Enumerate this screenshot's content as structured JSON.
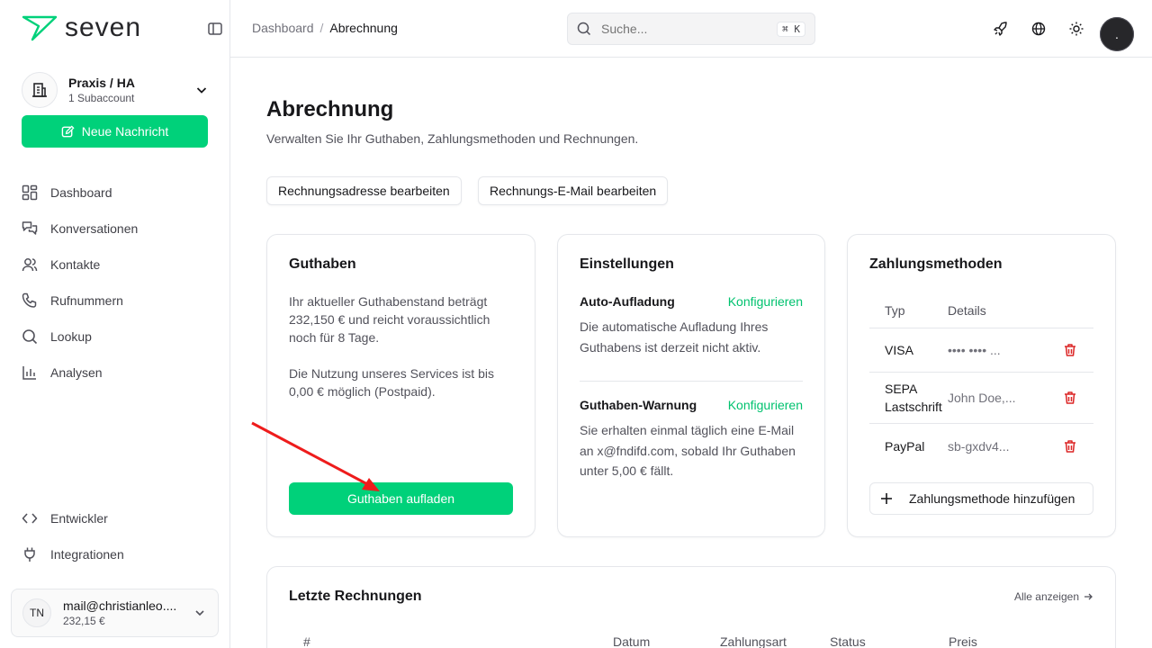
{
  "brand": {
    "name": "seven",
    "accent": "#00d17a"
  },
  "account": {
    "name": "Praxis / HA",
    "sub": "1 Subaccount"
  },
  "sidebar": {
    "new_message": "Neue Nachricht",
    "items": [
      {
        "label": "Dashboard",
        "icon": "dashboard-icon"
      },
      {
        "label": "Konversationen",
        "icon": "chat-icon"
      },
      {
        "label": "Kontakte",
        "icon": "users-icon"
      },
      {
        "label": "Rufnummern",
        "icon": "phone-icon"
      },
      {
        "label": "Lookup",
        "icon": "search-icon"
      },
      {
        "label": "Analysen",
        "icon": "chart-icon"
      }
    ],
    "bottom_items": [
      {
        "label": "Entwickler",
        "icon": "code-icon"
      },
      {
        "label": "Integrationen",
        "icon": "plug-icon"
      }
    ],
    "user": {
      "initials": "TN",
      "email": "mail@christianleo....",
      "balance": "232,15 €"
    }
  },
  "header": {
    "breadcrumb": [
      "Dashboard",
      "Abrechnung"
    ],
    "search_placeholder": "Suche...",
    "search_shortcut": "⌘ K",
    "avatar_text": "."
  },
  "page": {
    "title": "Abrechnung",
    "description": "Verwalten Sie Ihr Guthaben, Zahlungsmethoden und Rechnungen.",
    "actions": [
      "Rechnungsadresse bearbeiten",
      "Rechnungs-E-Mail bearbeiten"
    ]
  },
  "guthaben": {
    "title": "Guthaben",
    "text1": "Ihr aktueller Guthabenstand beträgt 232,150 € und reicht voraussichtlich noch für 8 Tage.",
    "text2": "Die Nutzung unseres Services ist bis 0,00 € möglich (Postpaid).",
    "button": "Guthaben aufladen"
  },
  "einstellungen": {
    "title": "Einstellungen",
    "auto": {
      "title": "Auto-Aufladung",
      "link": "Konfigurieren",
      "text": "Die automatische Aufladung Ihres Guthabens ist derzeit nicht aktiv."
    },
    "warn": {
      "title": "Guthaben-Warnung",
      "link": "Konfigurieren",
      "text": "Sie erhalten einmal täglich eine E-Mail an x@fndifd.com, sobald Ihr Guthaben unter 5,00 € fällt."
    }
  },
  "zahlungsmethoden": {
    "title": "Zahlungsmethoden",
    "columns": [
      "Typ",
      "Details"
    ],
    "rows": [
      {
        "type": "VISA",
        "details": "•••• •••• ..."
      },
      {
        "type": "SEPA Lastschrift",
        "details": "John Doe,..."
      },
      {
        "type": "PayPal",
        "details": "sb-gxdv4..."
      }
    ],
    "add": "Zahlungsmethode hinzufügen"
  },
  "rechnungen": {
    "title": "Letzte Rechnungen",
    "all": "Alle anzeigen",
    "columns": [
      "#",
      "Datum",
      "Zahlungsart",
      "Status",
      "Preis"
    ]
  }
}
